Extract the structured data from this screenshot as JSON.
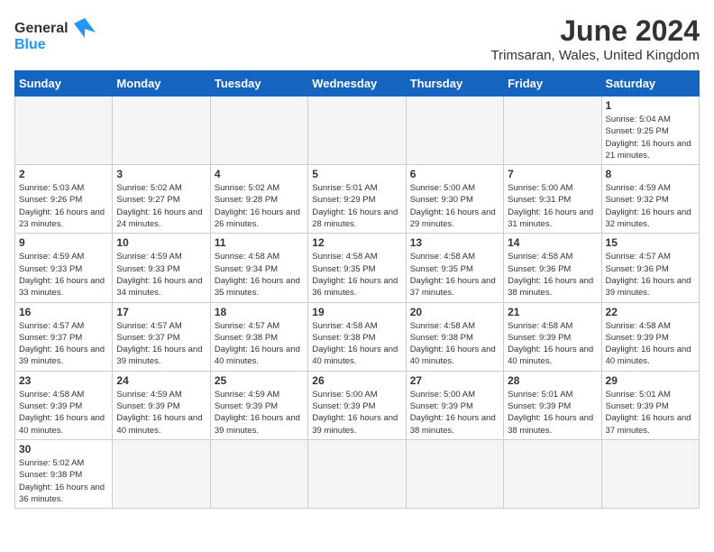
{
  "header": {
    "logo_general": "General",
    "logo_blue": "Blue",
    "month": "June 2024",
    "location": "Trimsaran, Wales, United Kingdom"
  },
  "days_of_week": [
    "Sunday",
    "Monday",
    "Tuesday",
    "Wednesday",
    "Thursday",
    "Friday",
    "Saturday"
  ],
  "weeks": [
    [
      {
        "day": "",
        "empty": true
      },
      {
        "day": "",
        "empty": true
      },
      {
        "day": "",
        "empty": true
      },
      {
        "day": "",
        "empty": true
      },
      {
        "day": "",
        "empty": true
      },
      {
        "day": "",
        "empty": true
      },
      {
        "day": "1",
        "sunrise": "Sunrise: 5:04 AM",
        "sunset": "Sunset: 9:25 PM",
        "daylight": "Daylight: 16 hours and 21 minutes."
      }
    ],
    [
      {
        "day": "2",
        "sunrise": "Sunrise: 5:03 AM",
        "sunset": "Sunset: 9:26 PM",
        "daylight": "Daylight: 16 hours and 23 minutes."
      },
      {
        "day": "3",
        "sunrise": "Sunrise: 5:02 AM",
        "sunset": "Sunset: 9:27 PM",
        "daylight": "Daylight: 16 hours and 24 minutes."
      },
      {
        "day": "4",
        "sunrise": "Sunrise: 5:02 AM",
        "sunset": "Sunset: 9:28 PM",
        "daylight": "Daylight: 16 hours and 26 minutes."
      },
      {
        "day": "5",
        "sunrise": "Sunrise: 5:01 AM",
        "sunset": "Sunset: 9:29 PM",
        "daylight": "Daylight: 16 hours and 28 minutes."
      },
      {
        "day": "6",
        "sunrise": "Sunrise: 5:00 AM",
        "sunset": "Sunset: 9:30 PM",
        "daylight": "Daylight: 16 hours and 29 minutes."
      },
      {
        "day": "7",
        "sunrise": "Sunrise: 5:00 AM",
        "sunset": "Sunset: 9:31 PM",
        "daylight": "Daylight: 16 hours and 31 minutes."
      },
      {
        "day": "8",
        "sunrise": "Sunrise: 4:59 AM",
        "sunset": "Sunset: 9:32 PM",
        "daylight": "Daylight: 16 hours and 32 minutes."
      }
    ],
    [
      {
        "day": "9",
        "sunrise": "Sunrise: 4:59 AM",
        "sunset": "Sunset: 9:33 PM",
        "daylight": "Daylight: 16 hours and 33 minutes."
      },
      {
        "day": "10",
        "sunrise": "Sunrise: 4:59 AM",
        "sunset": "Sunset: 9:33 PM",
        "daylight": "Daylight: 16 hours and 34 minutes."
      },
      {
        "day": "11",
        "sunrise": "Sunrise: 4:58 AM",
        "sunset": "Sunset: 9:34 PM",
        "daylight": "Daylight: 16 hours and 35 minutes."
      },
      {
        "day": "12",
        "sunrise": "Sunrise: 4:58 AM",
        "sunset": "Sunset: 9:35 PM",
        "daylight": "Daylight: 16 hours and 36 minutes."
      },
      {
        "day": "13",
        "sunrise": "Sunrise: 4:58 AM",
        "sunset": "Sunset: 9:35 PM",
        "daylight": "Daylight: 16 hours and 37 minutes."
      },
      {
        "day": "14",
        "sunrise": "Sunrise: 4:58 AM",
        "sunset": "Sunset: 9:36 PM",
        "daylight": "Daylight: 16 hours and 38 minutes."
      },
      {
        "day": "15",
        "sunrise": "Sunrise: 4:57 AM",
        "sunset": "Sunset: 9:36 PM",
        "daylight": "Daylight: 16 hours and 39 minutes."
      }
    ],
    [
      {
        "day": "16",
        "sunrise": "Sunrise: 4:57 AM",
        "sunset": "Sunset: 9:37 PM",
        "daylight": "Daylight: 16 hours and 39 minutes."
      },
      {
        "day": "17",
        "sunrise": "Sunrise: 4:57 AM",
        "sunset": "Sunset: 9:37 PM",
        "daylight": "Daylight: 16 hours and 39 minutes."
      },
      {
        "day": "18",
        "sunrise": "Sunrise: 4:57 AM",
        "sunset": "Sunset: 9:38 PM",
        "daylight": "Daylight: 16 hours and 40 minutes."
      },
      {
        "day": "19",
        "sunrise": "Sunrise: 4:58 AM",
        "sunset": "Sunset: 9:38 PM",
        "daylight": "Daylight: 16 hours and 40 minutes."
      },
      {
        "day": "20",
        "sunrise": "Sunrise: 4:58 AM",
        "sunset": "Sunset: 9:38 PM",
        "daylight": "Daylight: 16 hours and 40 minutes."
      },
      {
        "day": "21",
        "sunrise": "Sunrise: 4:58 AM",
        "sunset": "Sunset: 9:39 PM",
        "daylight": "Daylight: 16 hours and 40 minutes."
      },
      {
        "day": "22",
        "sunrise": "Sunrise: 4:58 AM",
        "sunset": "Sunset: 9:39 PM",
        "daylight": "Daylight: 16 hours and 40 minutes."
      }
    ],
    [
      {
        "day": "23",
        "sunrise": "Sunrise: 4:58 AM",
        "sunset": "Sunset: 9:39 PM",
        "daylight": "Daylight: 16 hours and 40 minutes."
      },
      {
        "day": "24",
        "sunrise": "Sunrise: 4:59 AM",
        "sunset": "Sunset: 9:39 PM",
        "daylight": "Daylight: 16 hours and 40 minutes."
      },
      {
        "day": "25",
        "sunrise": "Sunrise: 4:59 AM",
        "sunset": "Sunset: 9:39 PM",
        "daylight": "Daylight: 16 hours and 39 minutes."
      },
      {
        "day": "26",
        "sunrise": "Sunrise: 5:00 AM",
        "sunset": "Sunset: 9:39 PM",
        "daylight": "Daylight: 16 hours and 39 minutes."
      },
      {
        "day": "27",
        "sunrise": "Sunrise: 5:00 AM",
        "sunset": "Sunset: 9:39 PM",
        "daylight": "Daylight: 16 hours and 38 minutes."
      },
      {
        "day": "28",
        "sunrise": "Sunrise: 5:01 AM",
        "sunset": "Sunset: 9:39 PM",
        "daylight": "Daylight: 16 hours and 38 minutes."
      },
      {
        "day": "29",
        "sunrise": "Sunrise: 5:01 AM",
        "sunset": "Sunset: 9:39 PM",
        "daylight": "Daylight: 16 hours and 37 minutes."
      }
    ],
    [
      {
        "day": "30",
        "sunrise": "Sunrise: 5:02 AM",
        "sunset": "Sunset: 9:38 PM",
        "daylight": "Daylight: 16 hours and 36 minutes."
      },
      {
        "day": "",
        "empty": true
      },
      {
        "day": "",
        "empty": true
      },
      {
        "day": "",
        "empty": true
      },
      {
        "day": "",
        "empty": true
      },
      {
        "day": "",
        "empty": true
      },
      {
        "day": "",
        "empty": true
      }
    ]
  ]
}
